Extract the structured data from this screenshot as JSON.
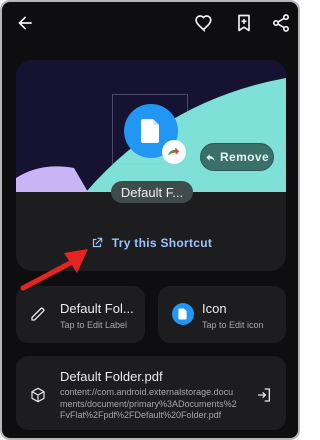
{
  "appbar": {
    "back_icon": "arrow-back-icon",
    "favorite_icon": "heart-outline-icon",
    "bookmark_icon": "bookmark-add-icon",
    "share_icon": "share-icon"
  },
  "preview": {
    "shortcut_icon": "document-icon",
    "badge_icon": "drive-share-icon",
    "remove_label": "Remove",
    "shortcut_name": "Default F...",
    "try_label": "Try this Shortcut",
    "try_icon": "open-in-new-icon",
    "colors": {
      "accent": "#2196f3",
      "wave": "#7ee0d6",
      "link": "#9cc4ff"
    }
  },
  "label_tile": {
    "title": "Default Fol...",
    "subtitle": "Tap to Edit Label",
    "icon": "pencil-icon"
  },
  "icon_tile": {
    "title": "Icon",
    "subtitle": "Tap to Edit icon",
    "icon": "document-icon"
  },
  "file_card": {
    "title": "Default Folder.pdf",
    "path": "content://com.android.externalstorage.documents/document/primary%3ADocuments%2FvFlat%2Fpdf%2FDefault%20Folder.pdf",
    "icon": "cube-icon",
    "action_icon": "open-in-icon"
  },
  "annotation": {
    "arrow_color": "#e52421"
  }
}
